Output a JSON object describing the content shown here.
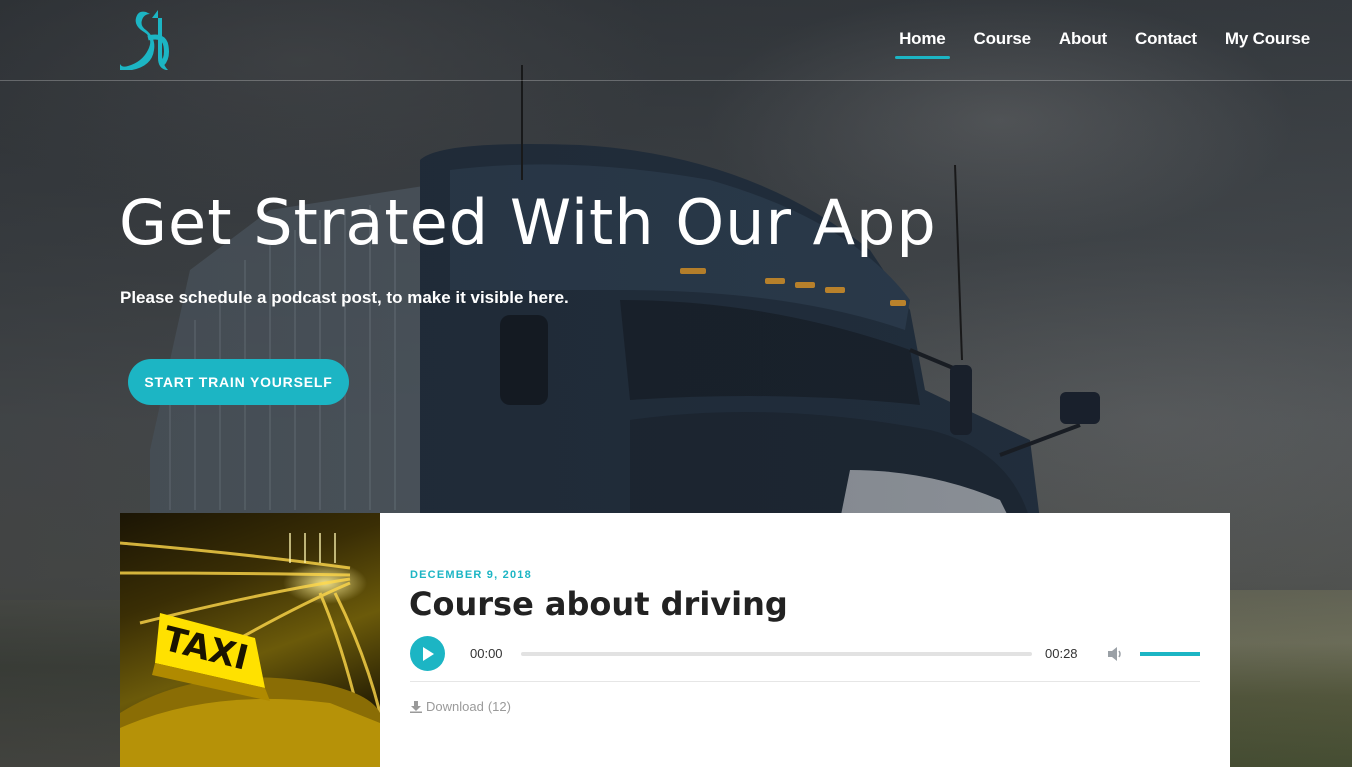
{
  "site": {
    "logo_icon": "brand-logo-sa",
    "accent_color": "#1cb5c4"
  },
  "nav": {
    "items": [
      {
        "label": "Home",
        "active": true
      },
      {
        "label": "Course",
        "active": false
      },
      {
        "label": "About",
        "active": false
      },
      {
        "label": "Contact",
        "active": false
      },
      {
        "label": "My Course",
        "active": false
      }
    ]
  },
  "hero": {
    "title": "Get Strated With Our App",
    "subtitle": "Please schedule a podcast post, to make it visible here.",
    "cta_label": "START TRAIN YOURSELF",
    "background_icon": "truck-photo"
  },
  "podcast": {
    "date": "DECEMBER 9, 2018",
    "title": "Course about driving",
    "image_icon": "taxi-sign-photo",
    "image_text": "TAXI",
    "player": {
      "current_time": "00:00",
      "duration": "00:28",
      "progress": 0,
      "volume": 1.0,
      "play_icon": "play-icon",
      "volume_icon": "volume-icon"
    },
    "download_label": "Download",
    "download_count": "(12)"
  }
}
